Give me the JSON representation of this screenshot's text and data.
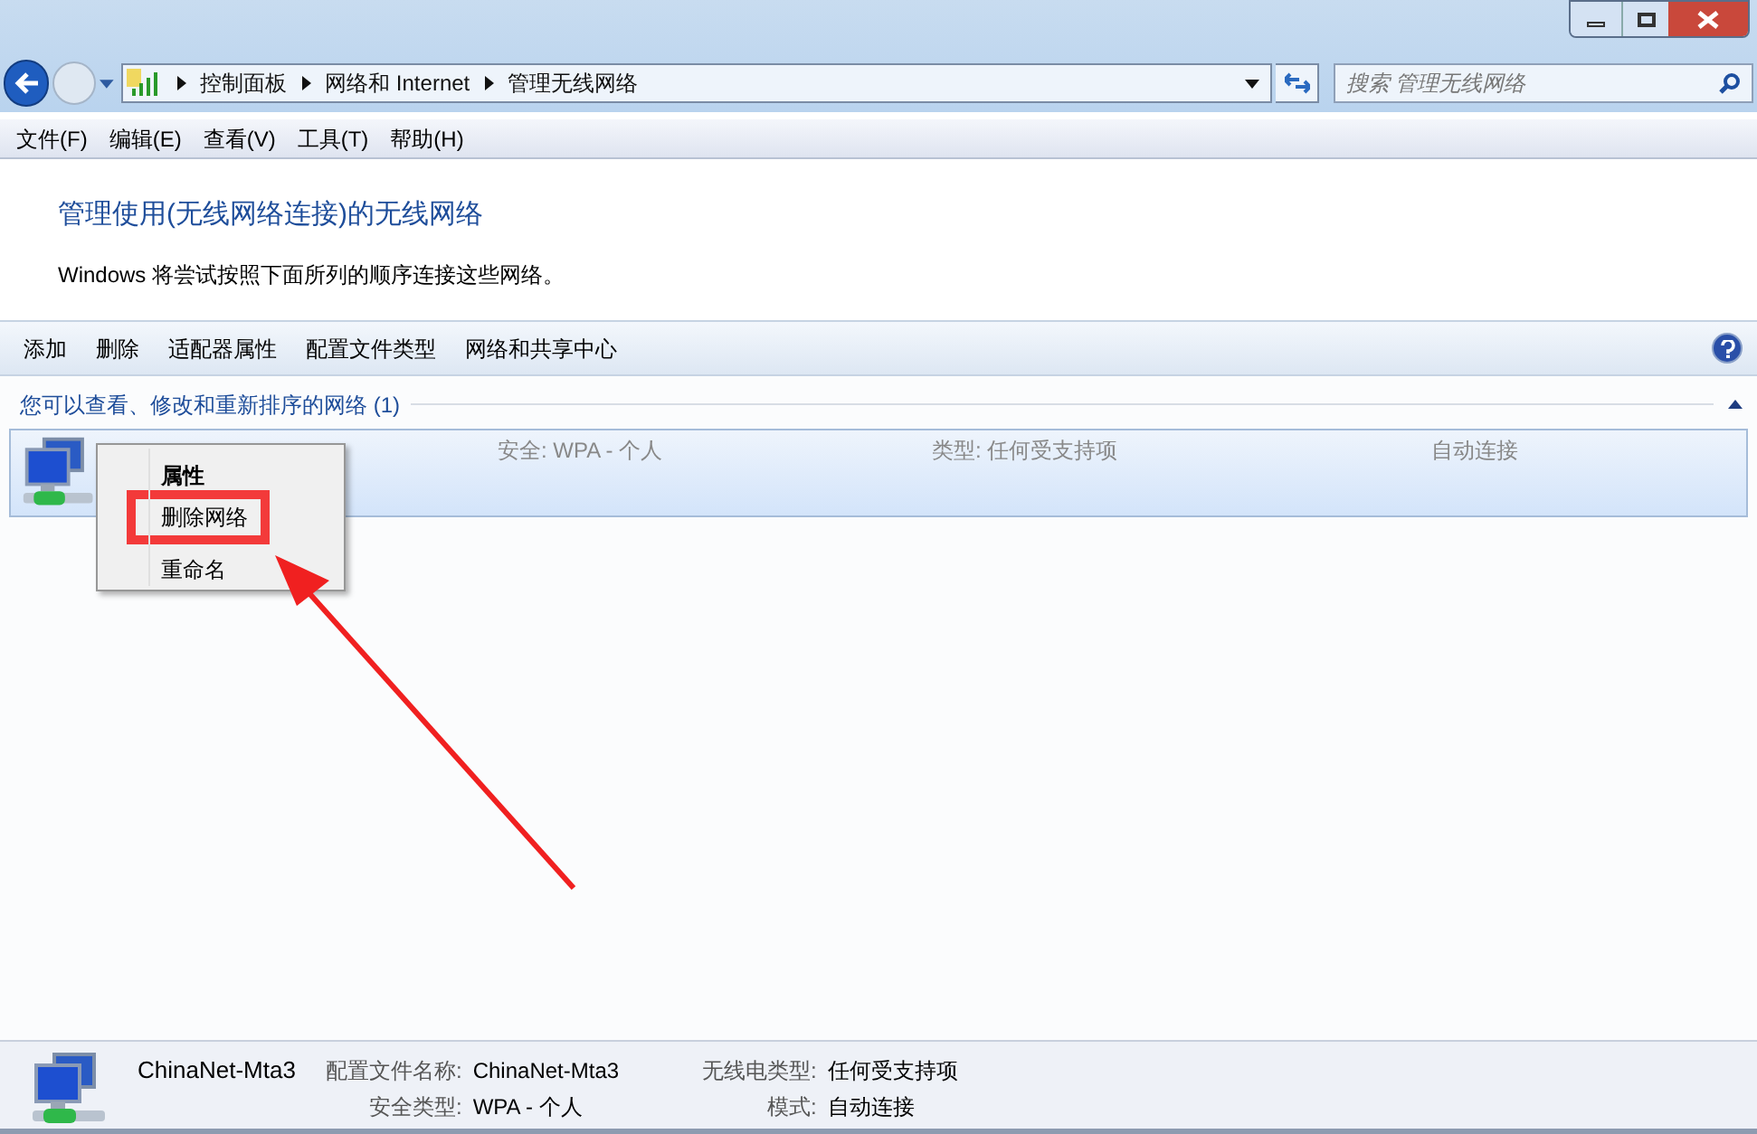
{
  "address_bar": {
    "crumbs": [
      "控制面板",
      "网络和 Internet",
      "管理无线网络"
    ]
  },
  "search": {
    "placeholder": "搜索 管理无线网络"
  },
  "menu_bar": [
    "文件(F)",
    "编辑(E)",
    "查看(V)",
    "工具(T)",
    "帮助(H)"
  ],
  "header": {
    "title": "管理使用(无线网络连接)的无线网络",
    "subtitle": "Windows 将尝试按照下面所列的顺序连接这些网络。"
  },
  "toolbar": [
    "添加",
    "删除",
    "适配器属性",
    "配置文件类型",
    "网络和共享中心"
  ],
  "group": {
    "title": "您可以查看、修改和重新排序的网络 (1)",
    "expanded": true,
    "networks": [
      {
        "security": "安全: WPA - 个人",
        "type": "类型: 任何受支持项",
        "mode": "自动连接",
        "selected": true
      }
    ]
  },
  "context_menu": [
    {
      "label": "属性",
      "bold": true,
      "annotated": false
    },
    {
      "label": "删除网络",
      "bold": false,
      "annotated": true
    },
    {
      "label": "重命名",
      "bold": false,
      "annotated": false
    }
  ],
  "details": {
    "name": "ChinaNet-Mta3",
    "fields": [
      {
        "label": "配置文件名称:",
        "value": "ChinaNet-Mta3"
      },
      {
        "label": "无线电类型:",
        "value": "任何受支持项"
      },
      {
        "label": "安全类型:",
        "value": "WPA - 个人"
      },
      {
        "label": "模式:",
        "value": "自动连接"
      }
    ]
  }
}
